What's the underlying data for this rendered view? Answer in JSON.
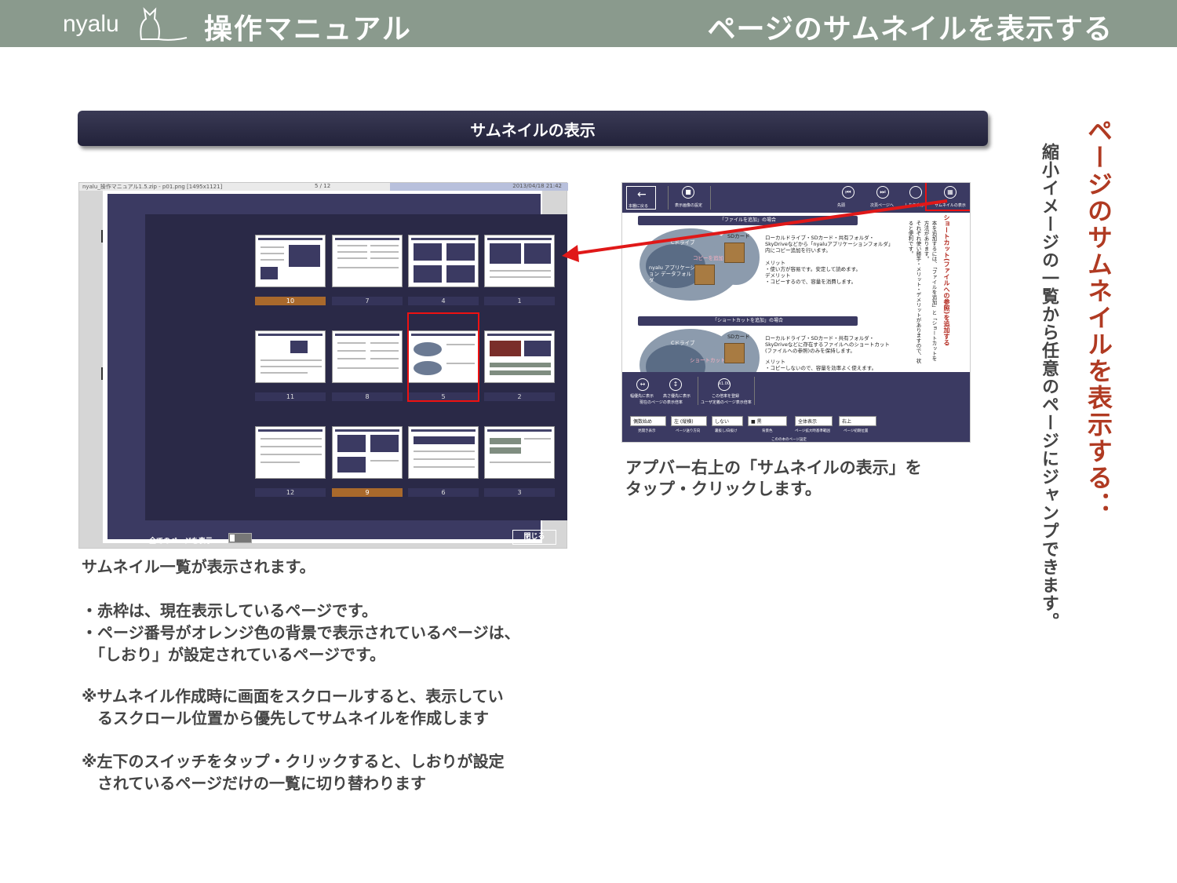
{
  "header": {
    "brand": "nyalu",
    "manual_title": "操作マニュアル",
    "page_title": "ページのサムネイルを表示する"
  },
  "banner": {
    "title": "サムネイルの表示"
  },
  "left_shot": {
    "titlebar_file": "nyalu_操作マニュアル1.5.zip - p01.png [1495x1121]",
    "titlebar_page": "5 / 12",
    "titlebar_date": "2013/04/18 21:42",
    "page_numbers": [
      "10",
      "7",
      "4",
      "1",
      "11",
      "8",
      "5",
      "2",
      "12",
      "9",
      "6",
      "3"
    ],
    "bookmarked": [
      "10",
      "9"
    ],
    "current_page": "5",
    "show_all_label": "全てのページを表示",
    "close_label": "閉じる"
  },
  "right_shot": {
    "back_label": "本棚に戻る",
    "fit_label": "表示画像の設定",
    "btn_first": "先頭",
    "btn_last": "次頁ページへ",
    "btn_bm": "しおり表示",
    "btn_thumb": "サムネイルの表示",
    "section1": "「ファイルを追加」の場合",
    "section2": "「ショートカットを追加」の場合",
    "c_drive": "Cドライブ",
    "sd_card": "SDカード",
    "app_folder": "nyalu アプリケーション データフォルダ",
    "copy_add": "コピーを追加",
    "shortcut": "ショートカット",
    "text1": "ローカルドライブ・SDカード・共有フォルダ・SkyDriveなどから「nyaluアプリケーションフォルダ」内にコピー追加を行います。",
    "text2": "メリット\n・使い方が容易です。安定して読めます。\nデメリット\n・コピーするので、容量を消費します。",
    "text3": "ローカルドライブ・SDカード・共有フォルダ・SkyDriveなどに存在するファイルへのショートカット(ファイルへの参照)のみを保持します。",
    "text4": "メリット\n・コピーしないので、容量を効率よく使えます。",
    "vert_red": "ショートカット(ファイルへの参照)を追加する",
    "vert_black_1": "本を追加するには、「ファイルを追加」と「ショートカットを",
    "vert_black_2": "方法があります。",
    "vert_black_3": "それぞれ使い勝手・メリット・デメリットがありますので、状",
    "vert_black_4": "ると便利です。",
    "appbar_btn1": "幅優先に表示",
    "appbar_btn2": "高さ優先に表示",
    "appbar_btn1_sub": "現在のページの表示倍率",
    "appbar_btn3": "この倍率を登録",
    "appbar_btn3_sub": "ユーザ定義のページ表示倍率",
    "dropdowns": [
      {
        "value": "偶数始め",
        "label": "見開き表示"
      },
      {
        "value": "左 (縦横)",
        "label": "ページ送り方向"
      },
      {
        "value": "しない",
        "label": "裏抜し/白抜け"
      },
      {
        "value": "■ 黒",
        "label": "背景色"
      },
      {
        "value": "全体表示",
        "label": "ページ拡大時基準範囲"
      },
      {
        "value": "右上",
        "label": "ページ初期位置"
      }
    ],
    "appbar_footer": "このの本のページ設定"
  },
  "caption_right": "アプバー右上の「サムネイルの表示」を\nタップ・クリックします。",
  "caption_left_1": "サムネイル一覧が表示されます。",
  "caption_left_2": "・赤枠は、現在表示しているページです。\n・ページ番号がオレンジ色の背景で表示されているページは、\n　「しおり」が設定されているページです。",
  "caption_left_3": "※サムネイル作成時に画面をスクロールすると、表示してい\n　るスクロール位置から優先してサムネイルを作成します",
  "caption_left_4": "※左下のスイッチをタップ・クリックすると、しおりが設定\n　されているページだけの一覧に切り替わります",
  "vertical_title": "ページのサムネイルを表示する：",
  "vertical_sub": "縮小イメージの一覧から任意のページにジャンプできます。",
  "colors": {
    "header_bg": "#8a9a8d",
    "accent_red": "#b03a22",
    "navy": "#3b3a62",
    "bookmark_orange": "#a9692c",
    "highlight_red": "#e11111"
  }
}
